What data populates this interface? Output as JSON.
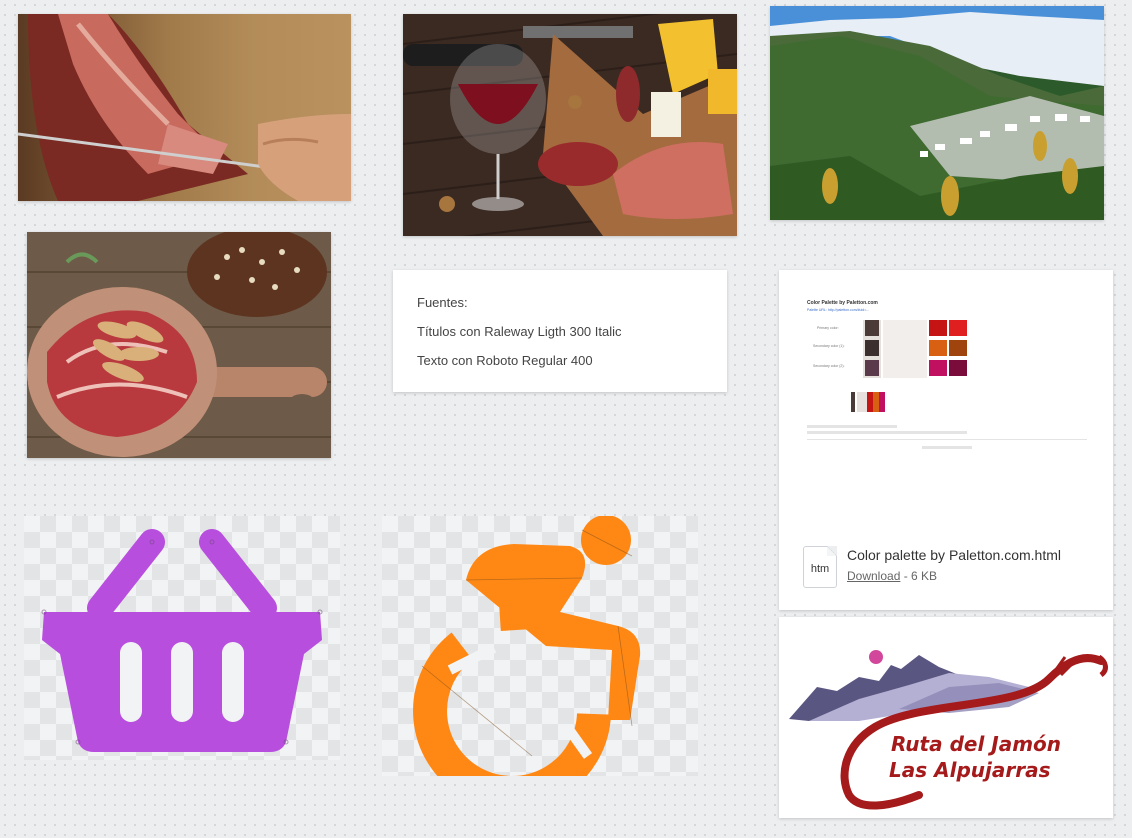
{
  "notes": {
    "fonts": {
      "heading": "Fuentes:",
      "titles": "Títulos con Raleway Ligth 300 Italic",
      "body": "Texto con Roboto Regular 400"
    }
  },
  "file": {
    "name": "Color palette by Paletton.com.html",
    "ext": "htm",
    "download_label": "Download",
    "size": "- 6 KB",
    "preview_title": "Color Palette by Paletton.com",
    "preview_link": "Palette URL: http://paletton.com/#uid=..."
  },
  "logo": {
    "line1": "Ruta del Jamón",
    "line2": "Las Alpujarras"
  },
  "colors": {
    "canvas": "#eceef0",
    "basket": "#b84ede",
    "wheelchair": "#ff8814",
    "logo_red": "#a51a1a",
    "logo_mountain": "#5a5682",
    "logo_dot": "#d2479b"
  },
  "images": {
    "img1": "ham-slicing-photo",
    "img2": "wine-cheese-ham-board-photo",
    "img3": "alpujarra-mountain-village-photo",
    "img4": "ham-board-with-bread-photo",
    "icon1": "shopping-basket-icon",
    "icon2": "wheelchair-accessibility-icon"
  }
}
